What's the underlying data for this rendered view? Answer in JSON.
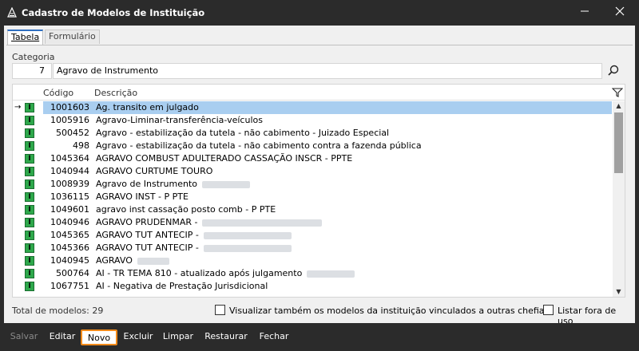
{
  "window": {
    "title": "Cadastro de Modelos de Instituição"
  },
  "tabs": [
    {
      "label": "Tabela"
    },
    {
      "label": "Formulário"
    }
  ],
  "category": {
    "label": "Categoria",
    "code": "7",
    "name": "Agravo de Instrumento"
  },
  "grid": {
    "headers": {
      "code": "Código",
      "description": "Descrição"
    },
    "rows": [
      {
        "code": "1001603",
        "description": "Ag. transito em julgado",
        "selected": true
      },
      {
        "code": "1005916",
        "description": "Agravo-Liminar-transferência-veículos"
      },
      {
        "code": "500452",
        "description": "Agravo - estabilização da tutela - não cabimento - Juizado Especial"
      },
      {
        "code": "498",
        "description": "Agravo - estabilização da tutela - não cabimento contra a fazenda pública"
      },
      {
        "code": "1045364",
        "description": "AGRAVO COMBUST ADULTERADO CASSAÇÃO INSCR - PPTE"
      },
      {
        "code": "1040944",
        "description": "AGRAVO CURTUME TOURO"
      },
      {
        "code": "1008939",
        "description": "Agravo de Instrumento"
      },
      {
        "code": "1036115",
        "description": "AGRAVO INST - P PTE"
      },
      {
        "code": "1049601",
        "description": "agravo inst cassação posto comb - P PTE"
      },
      {
        "code": "1040946",
        "description": "AGRAVO PRUDENMAR -"
      },
      {
        "code": "1045365",
        "description": "AGRAVO TUT ANTECIP -"
      },
      {
        "code": "1045366",
        "description": "AGRAVO TUT ANTECIP -"
      },
      {
        "code": "1040945",
        "description": "AGRAVO"
      },
      {
        "code": "500764",
        "description": "AI - TR TEMA 810 - atualizado após julgamento"
      },
      {
        "code": "1067751",
        "description": "AI - Negativa de Prestação Jurisdicional"
      }
    ]
  },
  "total_label": "Total de modelos: 29",
  "checkboxes": {
    "show_linked": "Visualizar também os modelos da instituição vinculados a outras chefias",
    "list_unused": "Listar fora de uso"
  },
  "footer": {
    "salvar": "Salvar",
    "editar": "Editar",
    "novo": "Novo",
    "excluir": "Excluir",
    "limpar": "Limpar",
    "restaurar": "Restaurar",
    "fechar": "Fechar"
  }
}
